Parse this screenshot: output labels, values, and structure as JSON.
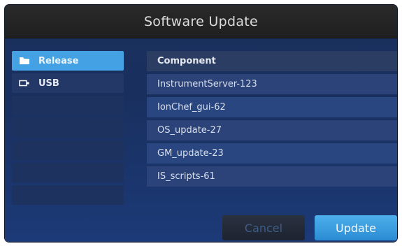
{
  "dialog": {
    "title": "Software Update"
  },
  "sidebar": {
    "items": [
      {
        "label": "Release",
        "icon": "folder-icon",
        "active": true
      },
      {
        "label": "USB",
        "icon": "usb-drive-icon",
        "active": false
      }
    ]
  },
  "list": {
    "header": "Component",
    "rows": [
      "InstrumentServer-123",
      "IonChef_gui-62",
      "OS_update-27",
      "GM_update-23",
      "IS_scripts-61"
    ]
  },
  "buttons": {
    "cancel": "Cancel",
    "update": "Update"
  },
  "colors": {
    "accent": "#44a2e4",
    "background": "#1a2f5c",
    "titlebar": "#262626"
  }
}
